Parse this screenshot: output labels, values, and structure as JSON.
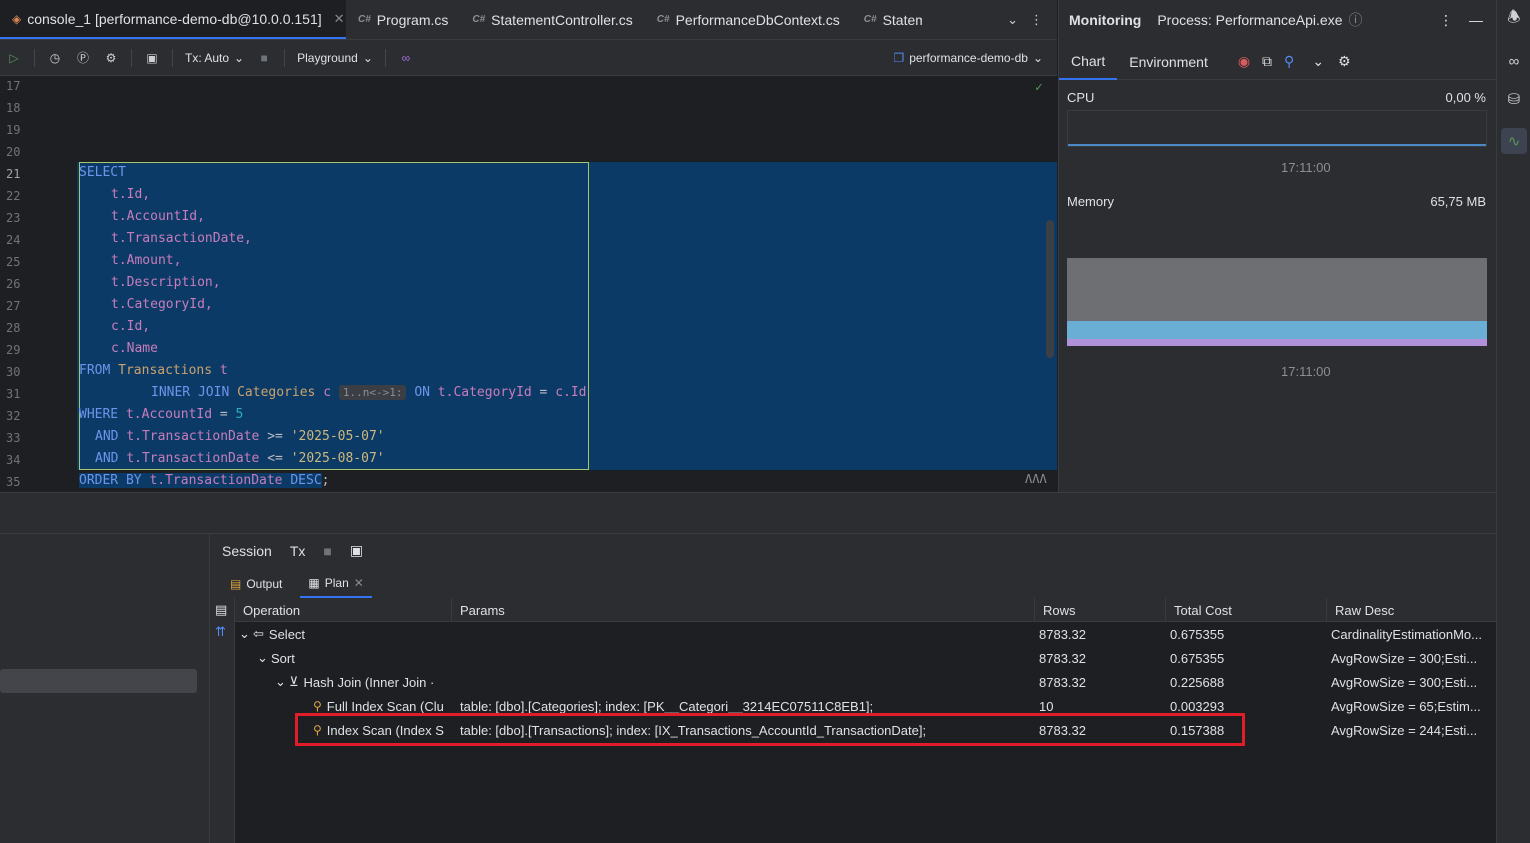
{
  "tabs": [
    {
      "label": "console_1 [performance-demo-db@10.0.0.151]",
      "active": true
    },
    {
      "label": "Program.cs",
      "lang": "C#"
    },
    {
      "label": "StatementController.cs",
      "lang": "C#"
    },
    {
      "label": "PerformanceDbContext.cs",
      "lang": "C#"
    },
    {
      "label": "Statem",
      "lang": "C#"
    }
  ],
  "toolbar": {
    "tx_label": "Tx: Auto",
    "playground_label": "Playground",
    "datasource_label": "performance-demo-db"
  },
  "editor": {
    "line_numbers": [
      "17",
      "18",
      "19",
      "20",
      "21",
      "22",
      "23",
      "24",
      "25",
      "26",
      "27",
      "28",
      "29",
      "30",
      "31",
      "32",
      "33",
      "34",
      "35"
    ],
    "lines": {
      "l21": "SELECT",
      "l22": "t.Id,",
      "l23": "t.AccountId,",
      "l24": "t.TransactionDate,",
      "l25": "t.Amount,",
      "l26": "t.Description,",
      "l27": "t.CategoryId,",
      "l28": "c.Id,",
      "l29": "c.Name",
      "l30_kw": "FROM",
      "l30_tbl": "Transactions",
      "l30_alias": "t",
      "l31_kw": "INNER JOIN",
      "l31_tbl": "Categories",
      "l31_alias": "c",
      "l31_hint": "1..n<->1:",
      "l31_on": "ON",
      "l31_cond_a": "t.CategoryId",
      "l31_eq": "=",
      "l31_cond_b": "c.Id",
      "l32_kw": "WHERE",
      "l32_col": "t.AccountId",
      "l32_eq": "=",
      "l32_val": "5",
      "l33_kw": "AND",
      "l33_col": "t.TransactionDate",
      "l33_op": ">=",
      "l33_val": "'2025-05-07'",
      "l34_kw": "AND",
      "l34_col": "t.TransactionDate",
      "l34_op": "<=",
      "l34_val": "'2025-08-07'",
      "l35_kw": "ORDER BY",
      "l35_col": "t.TransactionDate",
      "l35_dir": "DESC",
      "l35_end": ";"
    }
  },
  "monitoring": {
    "title": "Monitoring",
    "process": "Process: PerformanceApi.exe",
    "tabs": [
      "Chart",
      "Environment"
    ],
    "cpu_label": "CPU",
    "cpu_value": "0,00 %",
    "cpu_time": "17:11:00",
    "memory_label": "Memory",
    "memory_value": "65,75 MB",
    "memory_time": "17:11:00",
    "colors": {
      "memory_total": "#6e6f73",
      "memory_used": "#6aaed6",
      "memory_gc": "#b191d9",
      "cpu_line": "#4a88c7"
    }
  },
  "services": {
    "session_label": "Session",
    "tx_label": "Tx",
    "output_tab": "Output",
    "plan_tab": "Plan"
  },
  "plan": {
    "headers": {
      "operation": "Operation",
      "params": "Params",
      "rows": "Rows",
      "total_cost": "Total Cost",
      "raw_desc": "Raw Desc"
    },
    "rows": [
      {
        "op": "Select",
        "params": "",
        "rows": "8783.32",
        "cost": "0.675355",
        "raw": "CardinalityEstimationMo..."
      },
      {
        "op": "Sort",
        "params": "",
        "rows": "8783.32",
        "cost": "0.675355",
        "raw": "AvgRowSize = 300;Esti..."
      },
      {
        "op": "Hash Join (Inner Join ·",
        "params": "",
        "rows": "8783.32",
        "cost": "0.225688",
        "raw": "AvgRowSize = 300;Esti..."
      },
      {
        "op": "Full Index Scan (Clu",
        "params": "table: [dbo].[Categories]; index: [PK__Categori__3214EC07511C8EB1];",
        "rows": "10",
        "cost": "0.003293",
        "raw": "AvgRowSize = 65;Estim..."
      },
      {
        "op": "Index Scan (Index S",
        "params": "table: [dbo].[Transactions]; index: [IX_Transactions_AccountId_TransactionDate];",
        "rows": "8783.32",
        "cost": "0.157388",
        "raw": "AvgRowSize = 244;Esti..."
      }
    ]
  },
  "accent": "#3574f0",
  "highlight_color": "#e11d2a"
}
